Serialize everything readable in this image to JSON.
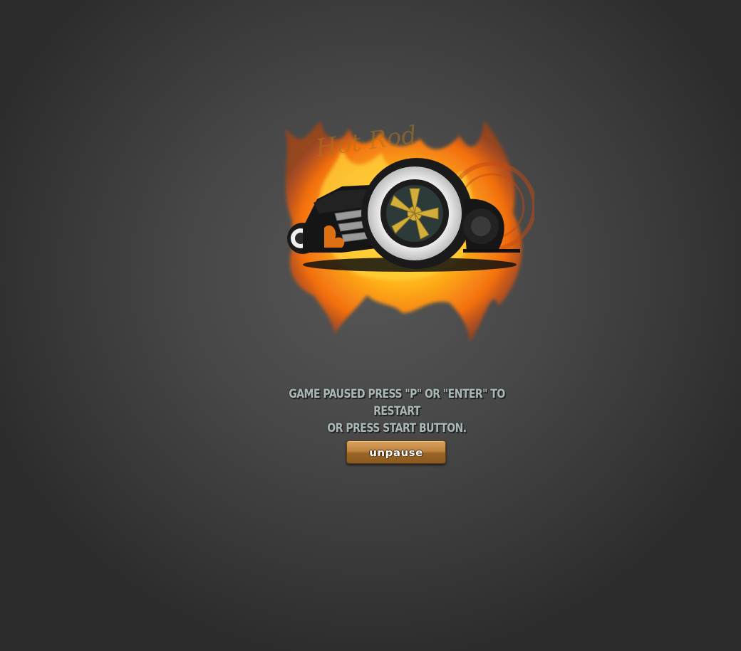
{
  "game": {
    "logo": {
      "icon": "hot-rod-flame-logo-icon",
      "text": "Hot Rod"
    },
    "pause_message": {
      "line1": "GAME PAUSED PRESS \"P\" OR \"ENTER\" TO RESTART",
      "line2": "OR PRESS START BUTTON."
    },
    "unpause_button": {
      "label": "unpause"
    }
  },
  "colors": {
    "background": "#474747",
    "message_text": "#aab7b7",
    "button_fill": "#bf8440",
    "flame_orange": "#f27a12",
    "flame_yellow": "#ffc21a",
    "wheel_hub": "#d4ae3a"
  }
}
